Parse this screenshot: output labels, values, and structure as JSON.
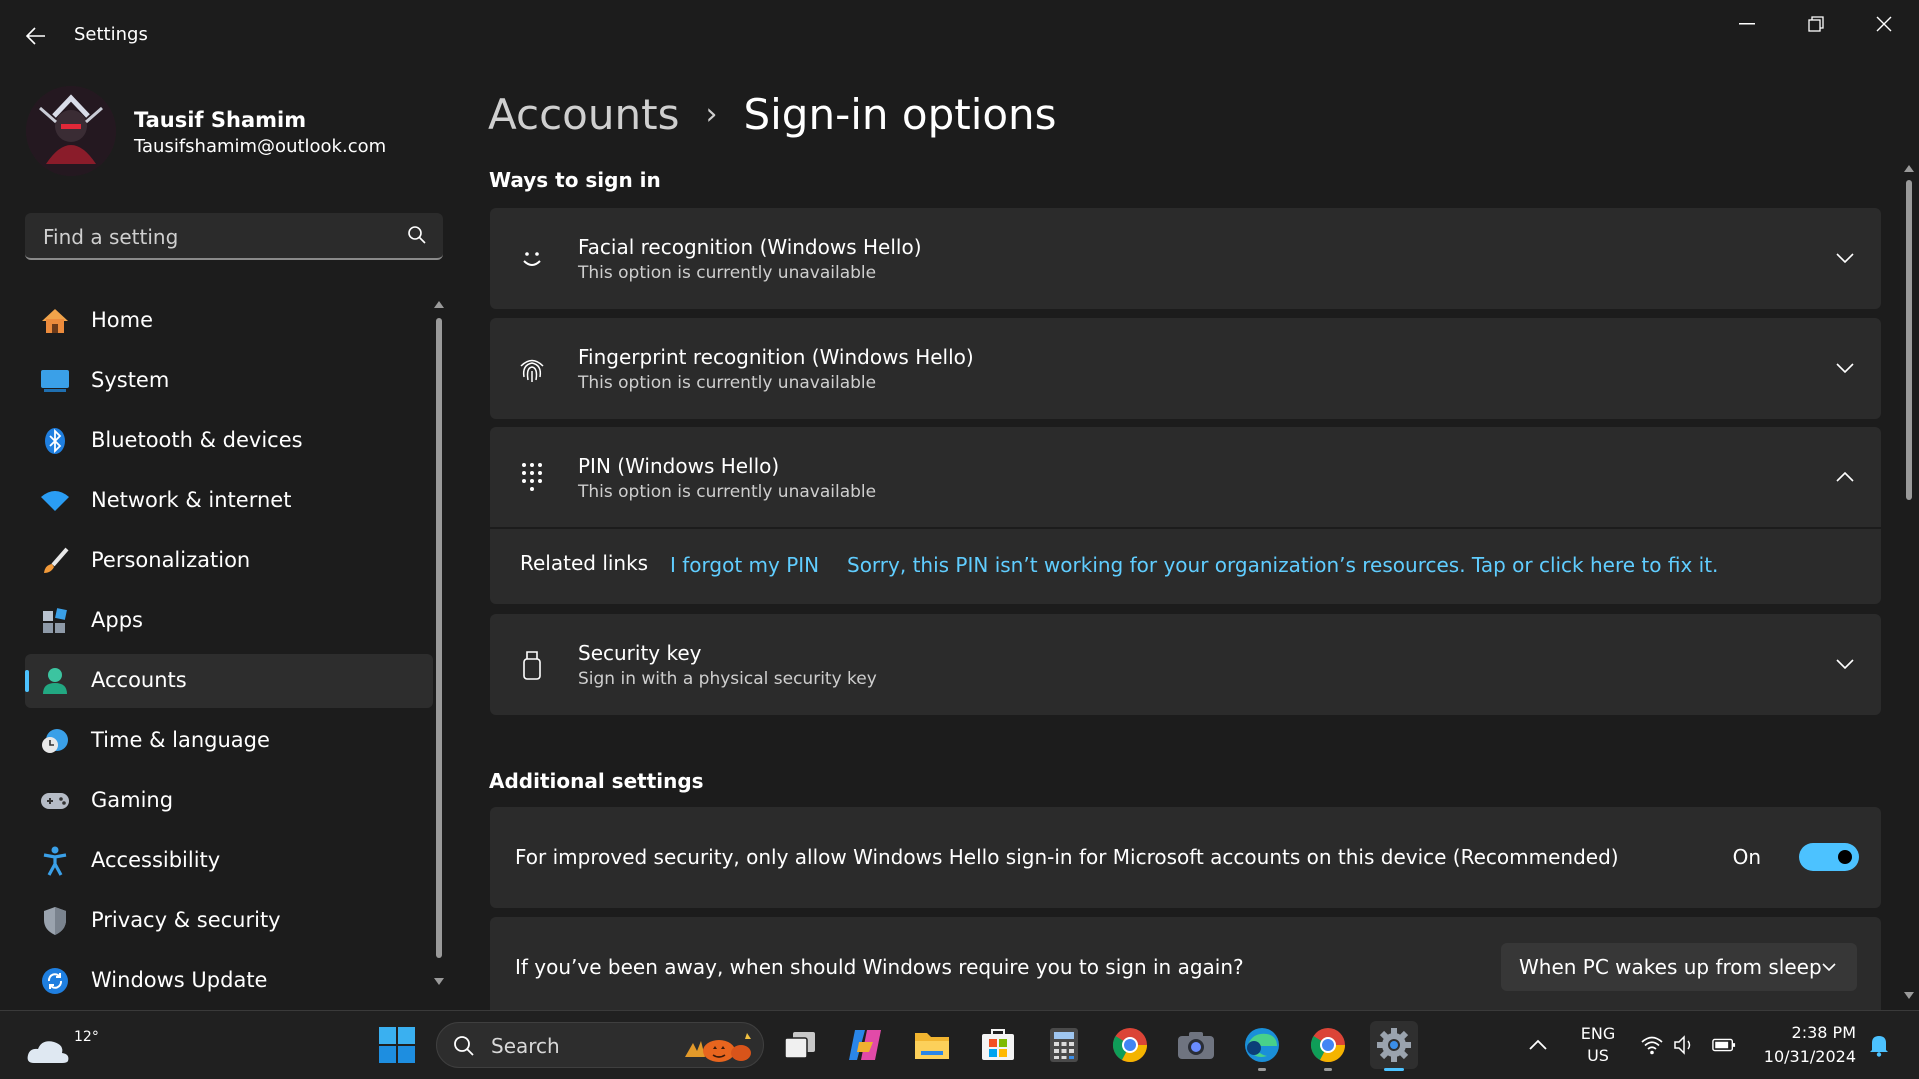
{
  "window": {
    "title": "Settings"
  },
  "profile": {
    "name": "Tausif Shamim",
    "email": "Tausifshamim@outlook.com"
  },
  "search": {
    "placeholder": "Find a setting"
  },
  "nav": {
    "items": [
      {
        "label": "Home",
        "icon": "home-icon"
      },
      {
        "label": "System",
        "icon": "system-icon"
      },
      {
        "label": "Bluetooth & devices",
        "icon": "bluetooth-icon"
      },
      {
        "label": "Network & internet",
        "icon": "wifi-icon"
      },
      {
        "label": "Personalization",
        "icon": "brush-icon"
      },
      {
        "label": "Apps",
        "icon": "apps-icon"
      },
      {
        "label": "Accounts",
        "icon": "accounts-icon",
        "active": true
      },
      {
        "label": "Time & language",
        "icon": "globe-clock-icon"
      },
      {
        "label": "Gaming",
        "icon": "gamepad-icon"
      },
      {
        "label": "Accessibility",
        "icon": "accessibility-icon"
      },
      {
        "label": "Privacy & security",
        "icon": "shield-icon"
      },
      {
        "label": "Windows Update",
        "icon": "update-icon"
      }
    ]
  },
  "breadcrumb": {
    "parent": "Accounts",
    "separator": "›",
    "current": "Sign-in options"
  },
  "ways": {
    "heading": "Ways to sign in",
    "options": [
      {
        "title": "Facial recognition (Windows Hello)",
        "subtitle": "This option is currently unavailable",
        "icon": "face-icon",
        "expanded": false
      },
      {
        "title": "Fingerprint recognition (Windows Hello)",
        "subtitle": "This option is currently unavailable",
        "icon": "fingerprint-icon",
        "expanded": false
      },
      {
        "title": "PIN (Windows Hello)",
        "subtitle": "This option is currently unavailable",
        "icon": "pin-keypad-icon",
        "expanded": true
      },
      {
        "title": "Security key",
        "subtitle": "Sign in with a physical security key",
        "icon": "usb-key-icon",
        "expanded": false
      }
    ],
    "related": {
      "label": "Related links",
      "link1": "I forgot my PIN",
      "link2": "Sorry, this PIN isn’t working for your organization’s resources. Tap or click here to fix it."
    }
  },
  "additional": {
    "heading": "Additional settings",
    "hello_only": {
      "text": "For improved security, only allow Windows Hello sign-in for Microsoft accounts on this device (Recommended)",
      "toggle_label": "On",
      "toggle_on": true
    },
    "require_signin": {
      "text": "If you’ve been away, when should Windows require you to sign in again?",
      "value": "When PC wakes up from sleep"
    }
  },
  "taskbar": {
    "weather_temp": "12°",
    "search_label": "Search",
    "apps": [
      "task-view-icon",
      "copilot-icon",
      "file-explorer-icon",
      "microsoft-store-icon",
      "calculator-icon",
      "chrome-icon",
      "camera-icon",
      "edge-icon",
      "chrome-icon",
      "settings-icon"
    ],
    "lang_line1": "ENG",
    "lang_line2": "US",
    "time": "2:38 PM",
    "date": "10/31/2024"
  },
  "colors": {
    "accent": "#4cc2ff",
    "link": "#60cdff",
    "card": "#2b2b2b",
    "background": "#1c1c1c"
  }
}
